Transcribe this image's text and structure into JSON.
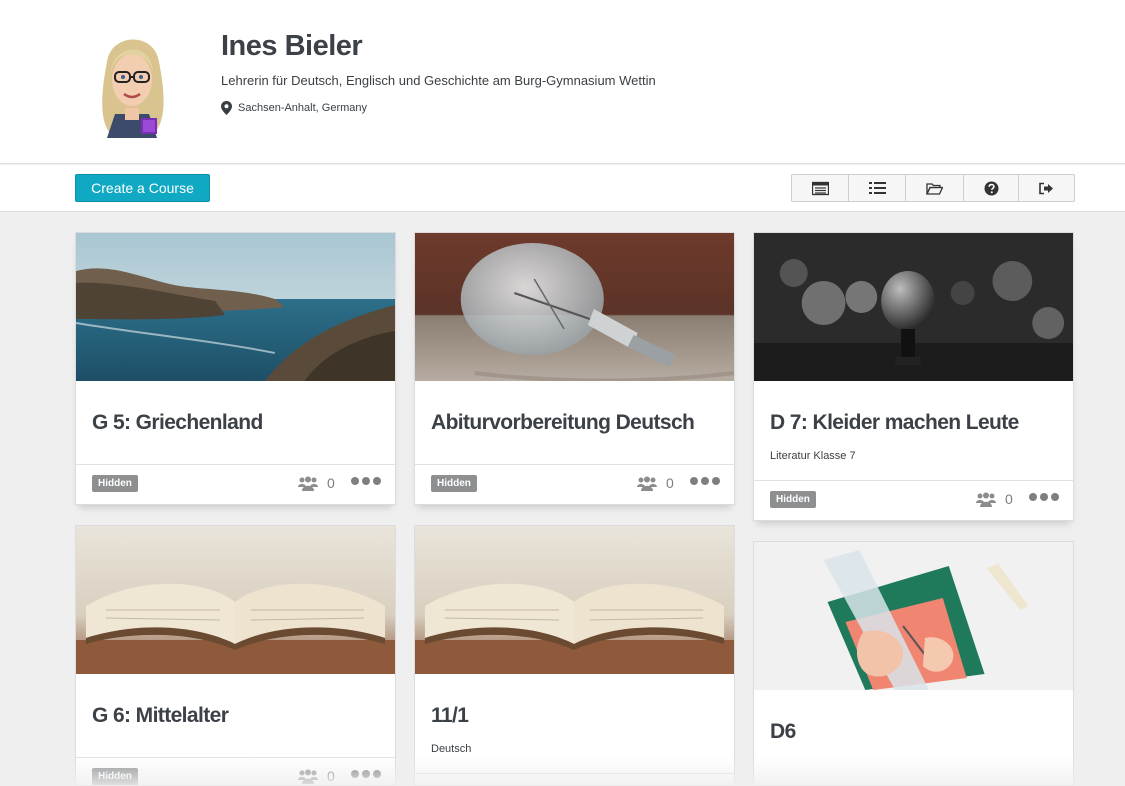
{
  "profile": {
    "name": "Ines Bieler",
    "bio": "Lehrerin für Deutsch, Englisch und Geschichte am Burg-Gymnasium Wettin",
    "location": "Sachsen-Anhalt, Germany"
  },
  "toolbar": {
    "create_label": "Create a Course",
    "icons": [
      "list-view-icon",
      "numbered-list-icon",
      "folder-open-icon",
      "help-icon",
      "sign-out-icon"
    ]
  },
  "colors": {
    "accent": "#10a9c3",
    "badge": "#8d8f91",
    "text": "#3c4148"
  },
  "courses": [
    {
      "title": "G 5: Griechenland",
      "subtitle": "",
      "badge": "Hidden",
      "members": "0",
      "image": "rocky-coast"
    },
    {
      "title": "Abiturvorbereitung Deutsch",
      "subtitle": "",
      "badge": "Hidden",
      "members": "0",
      "image": "light-bulb"
    },
    {
      "title": "D 7: Kleider machen Leute",
      "subtitle": "Literatur Klasse 7",
      "badge": "Hidden",
      "members": "0",
      "image": "microphone"
    },
    {
      "title": "G 6: Mittelalter",
      "subtitle": "",
      "badge": "Hidden",
      "members": "0",
      "image": "open-book"
    },
    {
      "title": "11/1",
      "subtitle": "Deutsch",
      "badge": "",
      "members": "",
      "image": "open-book"
    },
    {
      "title": "D6",
      "subtitle": "",
      "badge": "",
      "members": "",
      "image": "drawing-desk"
    }
  ]
}
